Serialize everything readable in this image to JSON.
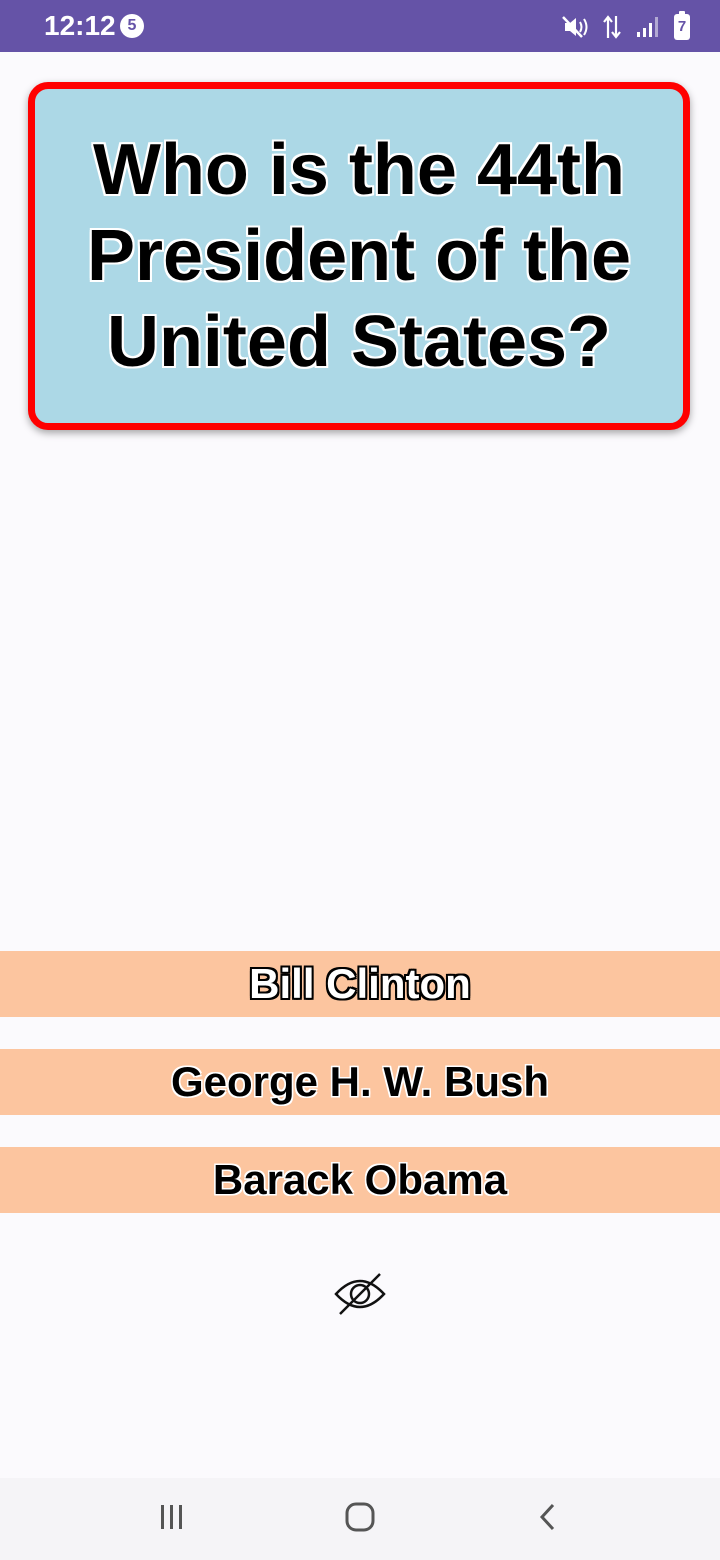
{
  "status_bar": {
    "time": "12:12",
    "notification_count": "5",
    "battery_level": "7",
    "icons": [
      "mute-vibrate-icon",
      "data-transfer-icon",
      "signal-icon",
      "battery-icon"
    ],
    "background_color": "#6553a7"
  },
  "question": {
    "text": "Who is the 44th President of the United States?",
    "card_color": "#acd8e6",
    "border_color": "#ff0000"
  },
  "answers": [
    {
      "label": "Bill Clinton",
      "style": "outlined"
    },
    {
      "label": "George H. W. Bush",
      "style": "filled"
    },
    {
      "label": "Barack Obama",
      "style": "filled"
    }
  ],
  "answer_color": "#fcc59f",
  "toggle": {
    "icon": "eye-off-icon"
  },
  "navigation": {
    "buttons": [
      "recents-icon",
      "home-icon",
      "back-icon"
    ]
  }
}
